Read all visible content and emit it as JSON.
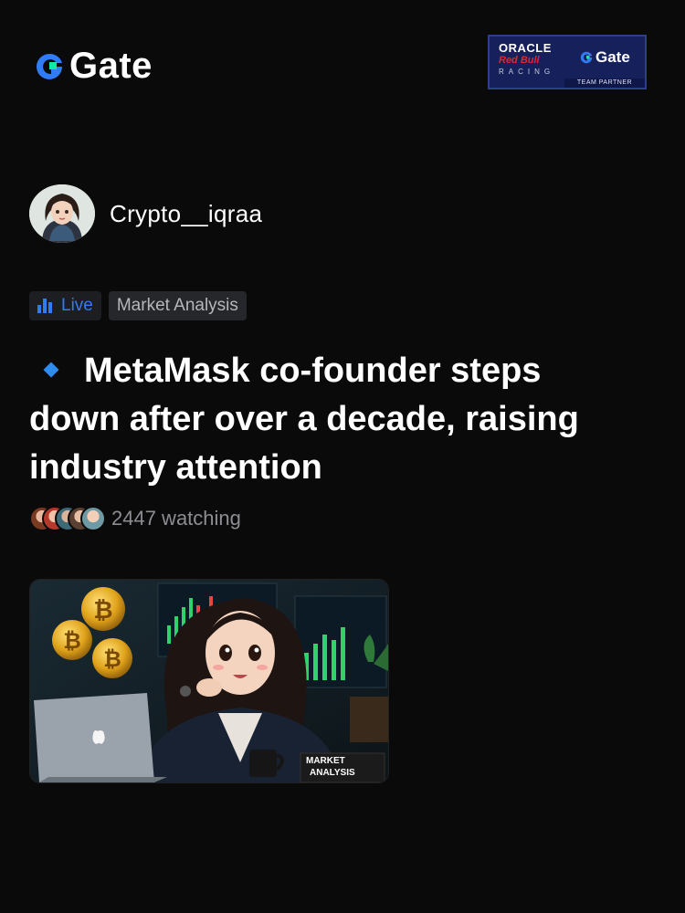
{
  "header": {
    "brand": "Gate",
    "partner_badge": {
      "line1": "ORACLE",
      "line2": "Red Bull",
      "line3": "RACING",
      "brand": "Gate",
      "footer": "TEAM PARTNER"
    }
  },
  "author": {
    "name": "Crypto__iqraa",
    "avatar_icon": "avatar-illustration"
  },
  "tags": {
    "live": "Live",
    "category": "Market Analysis"
  },
  "post": {
    "headline": "MetaMask co-founder steps down after over a decade, raising industry attention",
    "watching": "2447 watching"
  },
  "thumbnail": {
    "overlay_line1": "MARKET",
    "overlay_line2": "ANALYSIS"
  },
  "colors": {
    "background": "#0a0a0b",
    "accent": "#2f7cf6",
    "gate_green": "#17e5a0"
  }
}
